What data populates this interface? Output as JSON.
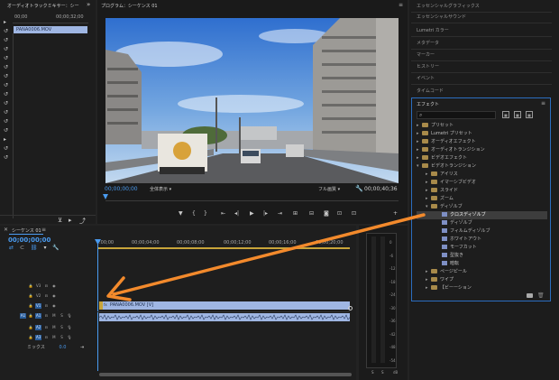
{
  "source_panel": {
    "tab_label": "オーディオトラックミキサー：シーケ",
    "timecode_start": "00;00",
    "timecode_end": "00;00;32;00",
    "clip_name": "PANA0006.MOV"
  },
  "program_monitor": {
    "title": "プログラム：シーケンス 01",
    "current_time": "00;00;00;00",
    "zoom_label": "全体表示",
    "quality_label": "フル画質",
    "duration": "00;00;40;36"
  },
  "workspace_menu": {
    "items": [
      "エッセンシャルグラフィックス",
      "エッセンシャルサウンド",
      "Lumetri カラー",
      "メタデータ",
      "マーカー",
      "ヒストリー",
      "イベント",
      "タイムコード"
    ]
  },
  "effects_panel": {
    "title": "エフェクト",
    "search_placeholder": "",
    "items": [
      {
        "label": "プリセット",
        "level": 0,
        "open": false,
        "kind": "folder"
      },
      {
        "label": "Lumetri プリセット",
        "level": 0,
        "open": false,
        "kind": "folder"
      },
      {
        "label": "オーディオエフェクト",
        "level": 0,
        "open": false,
        "kind": "folder"
      },
      {
        "label": "オーディオトランジション",
        "level": 0,
        "open": false,
        "kind": "folder"
      },
      {
        "label": "ビデオエフェクト",
        "level": 0,
        "open": false,
        "kind": "folder"
      },
      {
        "label": "ビデオトランジション",
        "level": 0,
        "open": true,
        "kind": "folder"
      },
      {
        "label": "アイリス",
        "level": 1,
        "open": false,
        "kind": "folder"
      },
      {
        "label": "イマーシブビデオ",
        "level": 1,
        "open": false,
        "kind": "folder"
      },
      {
        "label": "スライド",
        "level": 1,
        "open": false,
        "kind": "folder"
      },
      {
        "label": "ズーム",
        "level": 1,
        "open": false,
        "kind": "folder"
      },
      {
        "label": "ディゾルブ",
        "level": 1,
        "open": true,
        "kind": "folder"
      },
      {
        "label": "クロスディゾルブ",
        "level": 2,
        "open": false,
        "kind": "fx",
        "selected": true
      },
      {
        "label": "ディゾルブ",
        "level": 2,
        "open": false,
        "kind": "fx"
      },
      {
        "label": "フィルムディゾルブ",
        "level": 2,
        "open": false,
        "kind": "fx"
      },
      {
        "label": "ホワイトアウト",
        "level": 2,
        "open": false,
        "kind": "fx"
      },
      {
        "label": "モーフカット",
        "level": 2,
        "open": false,
        "kind": "fx"
      },
      {
        "label": "型抜き",
        "level": 2,
        "open": false,
        "kind": "fx"
      },
      {
        "label": "暗転",
        "level": 2,
        "open": false,
        "kind": "fx"
      },
      {
        "label": "ページピール",
        "level": 1,
        "open": false,
        "kind": "folder"
      },
      {
        "label": "ワイプ",
        "level": 1,
        "open": false,
        "kind": "folder"
      },
      {
        "label": "【ビーーション",
        "level": 1,
        "open": false,
        "kind": "folder"
      }
    ]
  },
  "timeline": {
    "tab_label": "シーケンス 01",
    "current_time": "00;00;00;00",
    "ruler_labels": [
      ":00;00",
      "00;00;04;00",
      "00;00;08;00",
      "00;00;12;00",
      "00;00;16;00",
      "00;00;20;00"
    ],
    "video_tracks": [
      "V3",
      "V2",
      "V1"
    ],
    "audio_tracks": [
      "A1",
      "A2",
      "A3"
    ],
    "mix_label": "ミックス",
    "mix_value": "0.0",
    "video_clip_label": "PANA0006.MOV [V]"
  },
  "audio_meter": {
    "scale": [
      "0",
      "-6",
      "-12",
      "-18",
      "-24",
      "-30",
      "-36",
      "-42",
      "-48",
      "-54"
    ],
    "bottom_labels": [
      "S",
      "S"
    ],
    "unit": "dB"
  },
  "colors": {
    "accent_blue": "#4a9bf0",
    "clip_blue": "#9fb6e3",
    "annotation_orange": "#f38a2c",
    "transition_yellow": "#c8a43a"
  }
}
